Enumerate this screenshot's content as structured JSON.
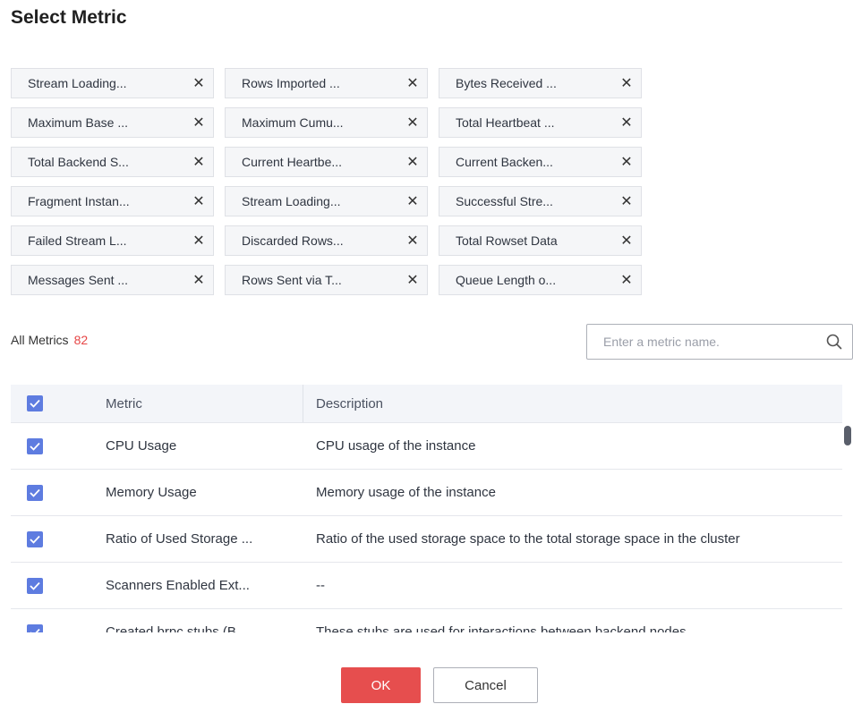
{
  "dialog": {
    "title": "Select Metric"
  },
  "selected_chips": [
    "Stream Loading...",
    "Rows Imported ...",
    "Bytes Received ...",
    "Maximum Base ...",
    "Maximum Cumu...",
    "Total Heartbeat ...",
    "Total Backend S...",
    "Current Heartbe...",
    "Current Backen...",
    "Fragment Instan...",
    "Stream Loading...",
    "Successful Stre...",
    "Failed Stream L...",
    "Discarded Rows...",
    "Total Rowset Data",
    "Messages Sent ...",
    "Rows Sent via T...",
    "Queue Length o..."
  ],
  "chip_remove_glyph": "✕",
  "all_metrics": {
    "label": "All Metrics",
    "count": "82"
  },
  "search": {
    "placeholder": "Enter a metric name."
  },
  "table": {
    "columns": {
      "metric": "Metric",
      "description": "Description"
    },
    "rows": [
      {
        "metric": "CPU Usage",
        "description": "CPU usage of the instance",
        "checked": true
      },
      {
        "metric": "Memory Usage",
        "description": "Memory usage of the instance",
        "checked": true
      },
      {
        "metric": "Ratio of Used Storage ...",
        "description": "Ratio of the used storage space to the total storage space in the cluster",
        "checked": true
      },
      {
        "metric": "Scanners Enabled Ext...",
        "description": "--",
        "checked": true
      },
      {
        "metric": "Created brpc stubs (B...",
        "description": "These stubs are used for interactions between backend nodes",
        "checked": true
      }
    ]
  },
  "buttons": {
    "ok": "OK",
    "cancel": "Cancel"
  },
  "colors": {
    "accent": "#5e7ce0",
    "primary_button": "#e64e4e",
    "count": "#e64545"
  }
}
